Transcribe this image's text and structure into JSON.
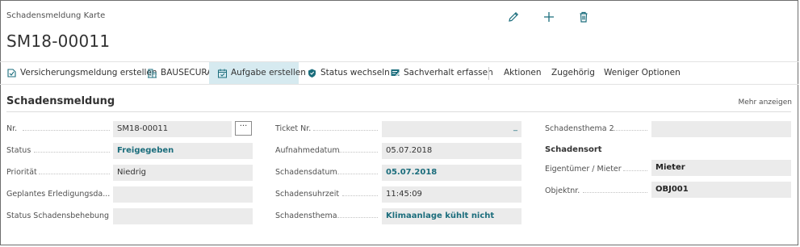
{
  "header": {
    "caption": "Schadensmeldung Karte",
    "title": "SM18-00011",
    "icons": [
      "pencil-icon",
      "plus-icon",
      "trash-icon"
    ]
  },
  "actions": [
    {
      "label": "Versicherungsmeldung erstellen",
      "icon": "report-icon"
    },
    {
      "label": "BAUSECURA",
      "icon": "building-icon"
    },
    {
      "label": "Aufgabe erstellen",
      "icon": "calendar-task-icon",
      "active": true
    },
    {
      "label": "Status wechseln",
      "icon": "status-icon"
    },
    {
      "label": "Sachverhalt erfassen",
      "icon": "edit-form-icon"
    }
  ],
  "menus": [
    "Aktionen",
    "Zugehörig",
    "Weniger Optionen"
  ],
  "section": {
    "title": "Schadensmeldung",
    "more_label": "Mehr anzeigen"
  },
  "fields": {
    "col1": [
      {
        "label": "Nr.",
        "value": "SM18-00011",
        "assist": "···"
      },
      {
        "label": "Status",
        "value": "Freigegeben"
      },
      {
        "label": "Priorität",
        "value": "Niedrig"
      },
      {
        "label": "Geplantes Erledigungsda...",
        "value": ""
      },
      {
        "label": "Status Schadensbehebung",
        "value": ""
      }
    ],
    "col2": [
      {
        "label": "Ticket Nr.",
        "value": "",
        "marker": "_"
      },
      {
        "label": "Aufnahmedatum",
        "value": "05.07.2018"
      },
      {
        "label": "Schadensdatum",
        "value": "05.07.2018"
      },
      {
        "label": "Schadensuhrzeit",
        "value": "11:45:09"
      },
      {
        "label": "Schadensthema",
        "value": "Klimaanlage kühlt nicht"
      }
    ],
    "col3": {
      "thema2": {
        "label": "Schadensthema 2",
        "value": ""
      },
      "subgroup_title": "Schadensort",
      "eigentuemer": {
        "label": "Eigentümer / Mieter",
        "value": "Mieter"
      },
      "objektnr": {
        "label": "Objektnr.",
        "value": "OBJ001"
      }
    }
  },
  "colors": {
    "accent": "#1b6d7c",
    "active_action_bg": "#d6eaf0",
    "field_bg": "#ebebeb"
  }
}
